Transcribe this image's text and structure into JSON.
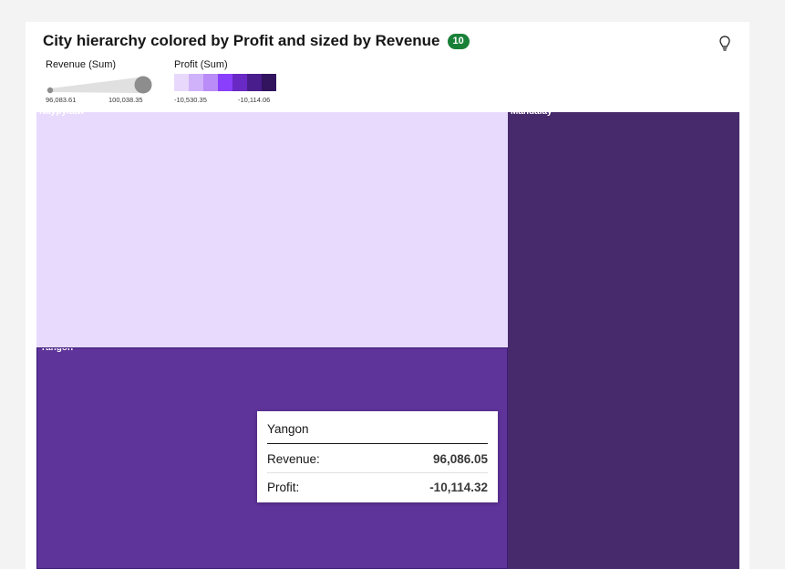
{
  "title": "City hierarchy colored by Profit and sized by Revenue",
  "badge": "10",
  "icon": "lightbulb-icon",
  "legend": {
    "size_title": "Revenue (Sum)",
    "size_min": "96,083.61",
    "size_max": "100,038.35",
    "color_title": "Profit (Sum)",
    "color_min": "-10,530.35",
    "color_max": "-10,114.06",
    "color_ramp": [
      "#e8d9fc",
      "#d0b2fa",
      "#b98cf7",
      "#8a3ffc",
      "#6929c4",
      "#491d8b",
      "#31135e"
    ]
  },
  "chart_data": {
    "type": "treemap",
    "title": "City hierarchy colored by Profit and sized by Revenue",
    "size_measure": "Revenue (Sum)",
    "color_measure": "Profit (Sum)",
    "size_range": [
      96083.61,
      100038.35
    ],
    "color_range": [
      -10530.35,
      -10114.06
    ],
    "items": [
      {
        "label": "Naypyitaw",
        "color": "#e8dafd"
      },
      {
        "label": "Mandalay",
        "color": "#472a6b"
      },
      {
        "label": "Yangon",
        "color": "#5e339a",
        "revenue": 96086.05,
        "profit": -10114.32
      }
    ]
  },
  "tooltip": {
    "name": "Yangon",
    "revenue_label": "Revenue:",
    "revenue_value": "96,086.05",
    "profit_label": "Profit:",
    "profit_value": "-10,114.32"
  }
}
